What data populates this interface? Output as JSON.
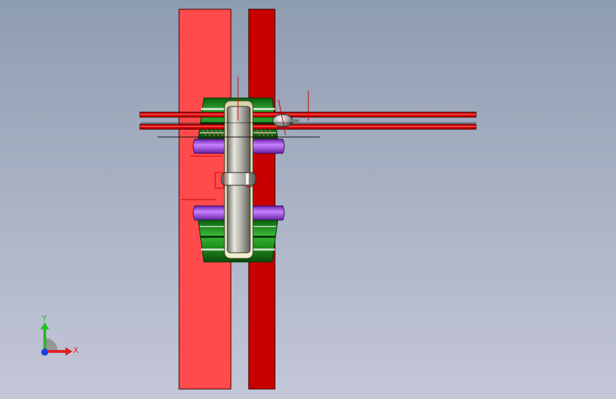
{
  "viewport": {
    "type": "cad-3d-view",
    "colors": {
      "background_top": "#8e9cb0",
      "background_bottom": "#c4c7d8",
      "left_plate": "#ff4b4b",
      "right_plate": "#c80000",
      "rail": "#d40000",
      "gear_green": "#1e8f1e",
      "gear_purple": "#9c3fd6",
      "shaft_silver": "#a8a8a0"
    }
  },
  "triad": {
    "x_label": "X",
    "y_label": "Y",
    "x_color": "#e02020",
    "y_color": "#20c020",
    "z_color": "#2040e0"
  }
}
